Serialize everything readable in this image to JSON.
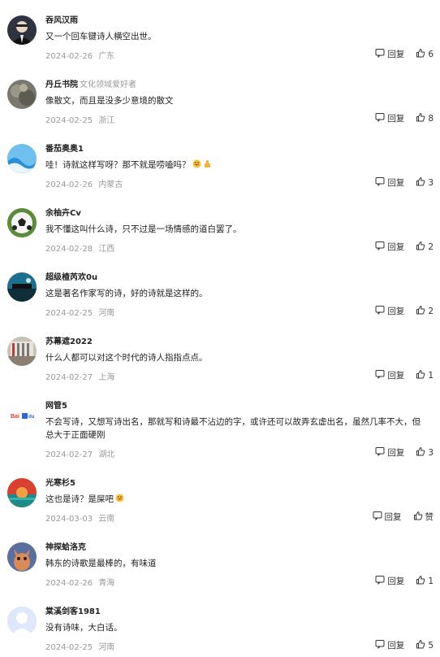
{
  "comments": [
    {
      "name": "吞风汉雨",
      "tag": "",
      "text": "又一个回车键诗人横空出世。",
      "date": "2024-02-26",
      "loc": "广东",
      "reply": "回复",
      "likes": "6",
      "avatar": "person"
    },
    {
      "name": "丹丘书院",
      "tag": "文化领域爱好者",
      "text": "像散文，而且是没多少意境的散文",
      "date": "2024-02-25",
      "loc": "浙江",
      "reply": "回复",
      "likes": "8",
      "avatar": "stone"
    },
    {
      "name": "番茄奥奥1",
      "tag": "",
      "text": "哇！诗就这样写呀？那不就是唠嗑吗？",
      "date": "2024-02-26",
      "loc": "内蒙古",
      "reply": "回复",
      "likes": "3",
      "avatar": "wave",
      "emojis": [
        "laugh-emoji",
        "thumb-emoji"
      ]
    },
    {
      "name": "余柚卉Cv",
      "tag": "",
      "text": "我不懂这叫什么诗，只不过是一场情感的道白罢了。",
      "date": "2024-02-28",
      "loc": "江西",
      "reply": "回复",
      "likes": "2",
      "avatar": "ball"
    },
    {
      "name": "超级楂芮欢0u",
      "tag": "",
      "text": "这是著名作家写的诗，好的诗就是这样的。",
      "date": "2024-02-25",
      "loc": "河南",
      "reply": "回复",
      "likes": "2",
      "avatar": "night"
    },
    {
      "name": "苏幕遮2022",
      "tag": "",
      "text": "什么人都可以对这个时代的诗人指指点点。",
      "date": "2024-02-27",
      "loc": "上海",
      "reply": "回复",
      "likes": "1",
      "avatar": "room"
    },
    {
      "name": "网管5",
      "tag": "",
      "text": "不会写诗，又想写诗出名，那就写和诗最不沾边的字，或许还可以故弄玄虚出名，虽然几率不大，但总大于正面硬刚",
      "date": "2024-02-27",
      "loc": "湖北",
      "reply": "回复",
      "likes": "3",
      "avatar": "baidu",
      "logo_text": "Bai du"
    },
    {
      "name": "光寒杉5",
      "tag": "",
      "text": "这也是诗？是屎吧",
      "date": "2024-03-03",
      "loc": "云南",
      "reply": "回复",
      "likes": "赞",
      "avatar": "sunset",
      "emojis": [
        "laugh-emoji"
      ]
    },
    {
      "name": "神探蛤洛克",
      "tag": "",
      "text": "韩东的诗歌是最棒的，有味道",
      "date": "2024-02-26",
      "loc": "青海",
      "reply": "回复",
      "likes": "1",
      "avatar": "cartoon"
    },
    {
      "name": "棠溪剑客1981",
      "tag": "",
      "text": "没有诗味，大白话。",
      "date": "2024-02-25",
      "loc": "河南",
      "reply": "回复",
      "likes": "5",
      "avatar": "default"
    }
  ],
  "colors": {
    "name": "#222222",
    "meta": "#999999",
    "text": "#222222",
    "action": "#333333"
  }
}
